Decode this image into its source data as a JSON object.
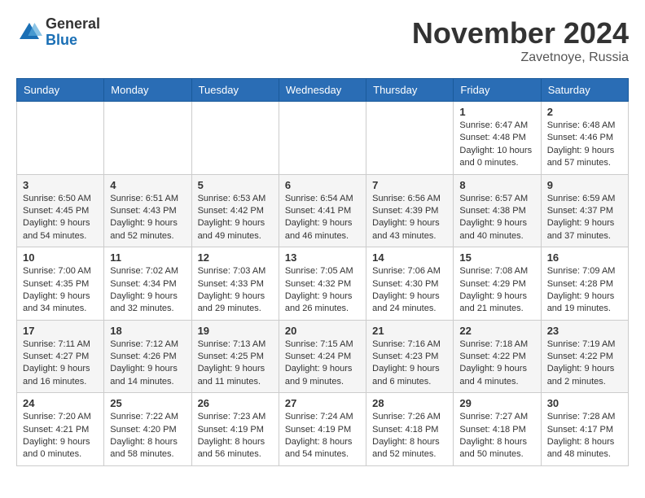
{
  "logo": {
    "general": "General",
    "blue": "Blue"
  },
  "title": "November 2024",
  "location": "Zavetnoye, Russia",
  "days_header": [
    "Sunday",
    "Monday",
    "Tuesday",
    "Wednesday",
    "Thursday",
    "Friday",
    "Saturday"
  ],
  "weeks": [
    [
      {
        "day": "",
        "info": ""
      },
      {
        "day": "",
        "info": ""
      },
      {
        "day": "",
        "info": ""
      },
      {
        "day": "",
        "info": ""
      },
      {
        "day": "",
        "info": ""
      },
      {
        "day": "1",
        "info": "Sunrise: 6:47 AM\nSunset: 4:48 PM\nDaylight: 10 hours\nand 0 minutes."
      },
      {
        "day": "2",
        "info": "Sunrise: 6:48 AM\nSunset: 4:46 PM\nDaylight: 9 hours\nand 57 minutes."
      }
    ],
    [
      {
        "day": "3",
        "info": "Sunrise: 6:50 AM\nSunset: 4:45 PM\nDaylight: 9 hours\nand 54 minutes."
      },
      {
        "day": "4",
        "info": "Sunrise: 6:51 AM\nSunset: 4:43 PM\nDaylight: 9 hours\nand 52 minutes."
      },
      {
        "day": "5",
        "info": "Sunrise: 6:53 AM\nSunset: 4:42 PM\nDaylight: 9 hours\nand 49 minutes."
      },
      {
        "day": "6",
        "info": "Sunrise: 6:54 AM\nSunset: 4:41 PM\nDaylight: 9 hours\nand 46 minutes."
      },
      {
        "day": "7",
        "info": "Sunrise: 6:56 AM\nSunset: 4:39 PM\nDaylight: 9 hours\nand 43 minutes."
      },
      {
        "day": "8",
        "info": "Sunrise: 6:57 AM\nSunset: 4:38 PM\nDaylight: 9 hours\nand 40 minutes."
      },
      {
        "day": "9",
        "info": "Sunrise: 6:59 AM\nSunset: 4:37 PM\nDaylight: 9 hours\nand 37 minutes."
      }
    ],
    [
      {
        "day": "10",
        "info": "Sunrise: 7:00 AM\nSunset: 4:35 PM\nDaylight: 9 hours\nand 34 minutes."
      },
      {
        "day": "11",
        "info": "Sunrise: 7:02 AM\nSunset: 4:34 PM\nDaylight: 9 hours\nand 32 minutes."
      },
      {
        "day": "12",
        "info": "Sunrise: 7:03 AM\nSunset: 4:33 PM\nDaylight: 9 hours\nand 29 minutes."
      },
      {
        "day": "13",
        "info": "Sunrise: 7:05 AM\nSunset: 4:32 PM\nDaylight: 9 hours\nand 26 minutes."
      },
      {
        "day": "14",
        "info": "Sunrise: 7:06 AM\nSunset: 4:30 PM\nDaylight: 9 hours\nand 24 minutes."
      },
      {
        "day": "15",
        "info": "Sunrise: 7:08 AM\nSunset: 4:29 PM\nDaylight: 9 hours\nand 21 minutes."
      },
      {
        "day": "16",
        "info": "Sunrise: 7:09 AM\nSunset: 4:28 PM\nDaylight: 9 hours\nand 19 minutes."
      }
    ],
    [
      {
        "day": "17",
        "info": "Sunrise: 7:11 AM\nSunset: 4:27 PM\nDaylight: 9 hours\nand 16 minutes."
      },
      {
        "day": "18",
        "info": "Sunrise: 7:12 AM\nSunset: 4:26 PM\nDaylight: 9 hours\nand 14 minutes."
      },
      {
        "day": "19",
        "info": "Sunrise: 7:13 AM\nSunset: 4:25 PM\nDaylight: 9 hours\nand 11 minutes."
      },
      {
        "day": "20",
        "info": "Sunrise: 7:15 AM\nSunset: 4:24 PM\nDaylight: 9 hours\nand 9 minutes."
      },
      {
        "day": "21",
        "info": "Sunrise: 7:16 AM\nSunset: 4:23 PM\nDaylight: 9 hours\nand 6 minutes."
      },
      {
        "day": "22",
        "info": "Sunrise: 7:18 AM\nSunset: 4:22 PM\nDaylight: 9 hours\nand 4 minutes."
      },
      {
        "day": "23",
        "info": "Sunrise: 7:19 AM\nSunset: 4:22 PM\nDaylight: 9 hours\nand 2 minutes."
      }
    ],
    [
      {
        "day": "24",
        "info": "Sunrise: 7:20 AM\nSunset: 4:21 PM\nDaylight: 9 hours\nand 0 minutes."
      },
      {
        "day": "25",
        "info": "Sunrise: 7:22 AM\nSunset: 4:20 PM\nDaylight: 8 hours\nand 58 minutes."
      },
      {
        "day": "26",
        "info": "Sunrise: 7:23 AM\nSunset: 4:19 PM\nDaylight: 8 hours\nand 56 minutes."
      },
      {
        "day": "27",
        "info": "Sunrise: 7:24 AM\nSunset: 4:19 PM\nDaylight: 8 hours\nand 54 minutes."
      },
      {
        "day": "28",
        "info": "Sunrise: 7:26 AM\nSunset: 4:18 PM\nDaylight: 8 hours\nand 52 minutes."
      },
      {
        "day": "29",
        "info": "Sunrise: 7:27 AM\nSunset: 4:18 PM\nDaylight: 8 hours\nand 50 minutes."
      },
      {
        "day": "30",
        "info": "Sunrise: 7:28 AM\nSunset: 4:17 PM\nDaylight: 8 hours\nand 48 minutes."
      }
    ]
  ]
}
